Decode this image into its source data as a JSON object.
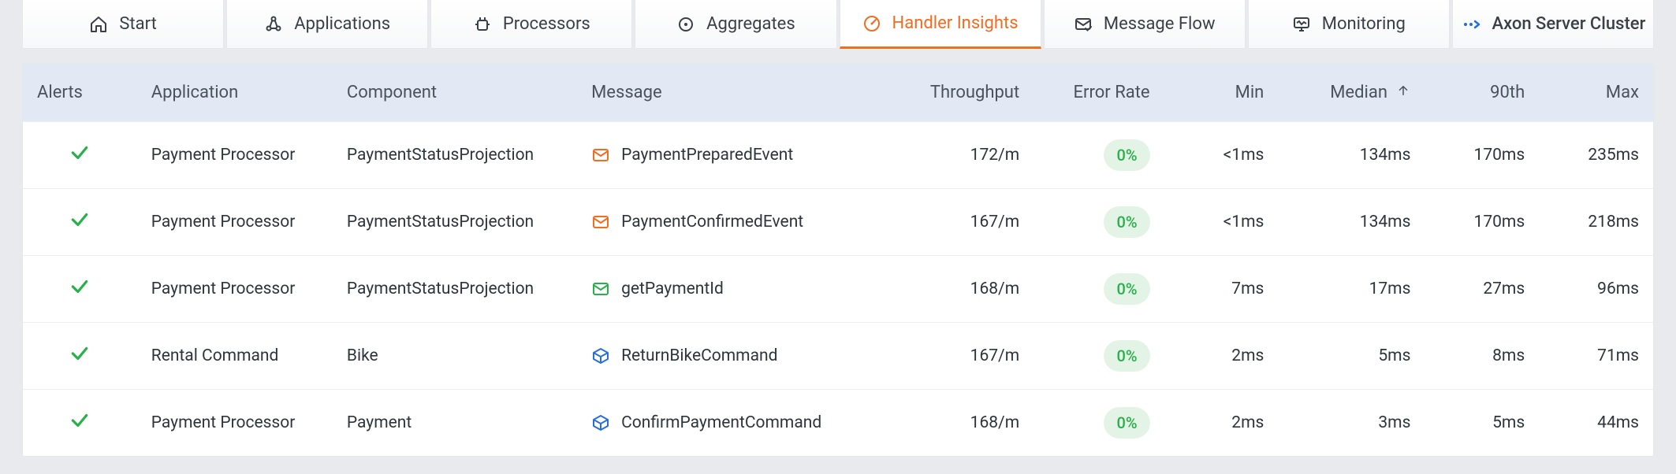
{
  "tabs": [
    {
      "id": "start",
      "label": "Start",
      "icon": "home-icon"
    },
    {
      "id": "apps",
      "label": "Applications",
      "icon": "apps-icon"
    },
    {
      "id": "processors",
      "label": "Processors",
      "icon": "processors-icon"
    },
    {
      "id": "aggregates",
      "label": "Aggregates",
      "icon": "target-icon"
    },
    {
      "id": "handler",
      "label": "Handler Insights",
      "icon": "gauge-icon",
      "active": true
    },
    {
      "id": "msgflow",
      "label": "Message Flow",
      "icon": "mail-check-icon"
    },
    {
      "id": "monitoring",
      "label": "Monitoring",
      "icon": "monitor-icon"
    },
    {
      "id": "cluster",
      "label": "Axon Server Cluster",
      "icon": "cluster-icon"
    }
  ],
  "table": {
    "headers": {
      "alerts": "Alerts",
      "application": "Application",
      "component": "Component",
      "message": "Message",
      "throughput": "Throughput",
      "error_rate": "Error Rate",
      "min": "Min",
      "median": "Median",
      "p90": "90th",
      "max": "Max"
    },
    "sort": {
      "column": "median",
      "dir": "asc"
    },
    "rows": [
      {
        "alert": "ok",
        "application": "Payment Processor",
        "component": "PaymentStatusProjection",
        "message_icon": "envelope-orange",
        "message": "PaymentPreparedEvent",
        "throughput": "172/m",
        "error_rate": "0%",
        "min": "<1ms",
        "median": "134ms",
        "p90": "170ms",
        "max": "235ms"
      },
      {
        "alert": "ok",
        "application": "Payment Processor",
        "component": "PaymentStatusProjection",
        "message_icon": "envelope-orange",
        "message": "PaymentConfirmedEvent",
        "throughput": "167/m",
        "error_rate": "0%",
        "min": "<1ms",
        "median": "134ms",
        "p90": "170ms",
        "max": "218ms"
      },
      {
        "alert": "ok",
        "application": "Payment Processor",
        "component": "PaymentStatusProjection",
        "message_icon": "envelope-green",
        "message": "getPaymentId",
        "throughput": "168/m",
        "error_rate": "0%",
        "min": "7ms",
        "median": "17ms",
        "p90": "27ms",
        "max": "96ms"
      },
      {
        "alert": "ok",
        "application": "Rental Command",
        "component": "Bike",
        "message_icon": "cube-blue",
        "message": "ReturnBikeCommand",
        "throughput": "167/m",
        "error_rate": "0%",
        "min": "2ms",
        "median": "5ms",
        "p90": "8ms",
        "max": "71ms"
      },
      {
        "alert": "ok",
        "application": "Payment Processor",
        "component": "Payment",
        "message_icon": "cube-blue",
        "message": "ConfirmPaymentCommand",
        "throughput": "168/m",
        "error_rate": "0%",
        "min": "2ms",
        "median": "3ms",
        "p90": "5ms",
        "max": "44ms"
      }
    ]
  }
}
